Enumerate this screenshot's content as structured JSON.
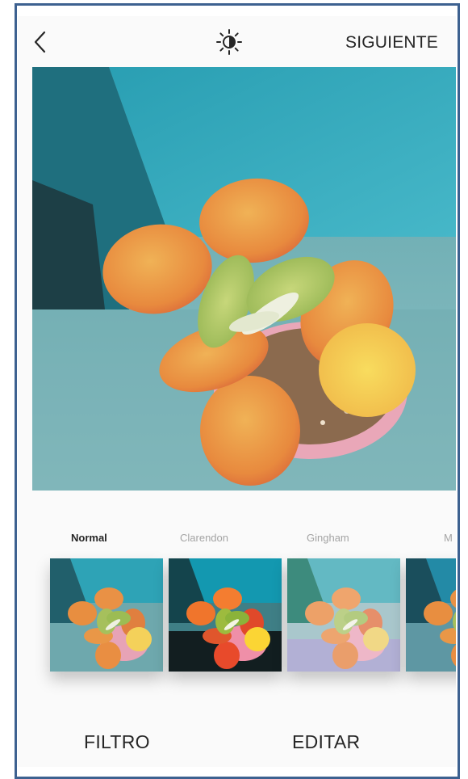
{
  "header": {
    "back_icon": "chevron-left-icon",
    "brightness_icon": "sun-icon",
    "next_label": "SIGUIENTE"
  },
  "photo": {
    "subject": "succulent-plant-photo"
  },
  "filters": [
    {
      "label": "Normal",
      "selected": true
    },
    {
      "label": "Clarendon",
      "selected": false
    },
    {
      "label": "Gingham",
      "selected": false
    },
    {
      "label": "M",
      "selected": false
    }
  ],
  "tabs": {
    "filter_label": "FILTRO",
    "edit_label": "EDITAR"
  },
  "colors": {
    "frame_border": "#3d6190",
    "text_primary": "#262626",
    "text_muted": "#a4a4a4",
    "background": "#fafafa"
  }
}
